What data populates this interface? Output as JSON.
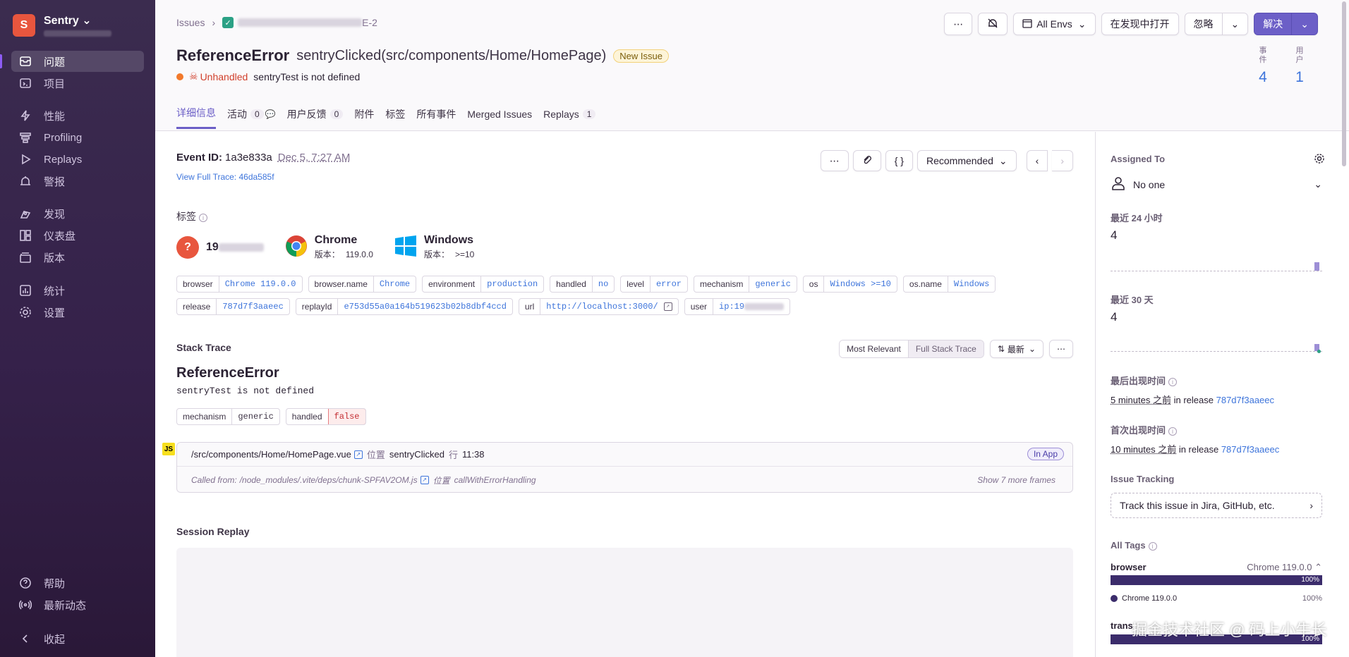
{
  "sidebar": {
    "org_initial": "S",
    "org_name": "Sentry",
    "items": [
      {
        "label": "问题",
        "icon": "issues-icon"
      },
      {
        "label": "项目",
        "icon": "projects-icon"
      },
      {
        "label": "性能",
        "icon": "performance-icon"
      },
      {
        "label": "Profiling",
        "icon": "profiling-icon"
      },
      {
        "label": "Replays",
        "icon": "replays-icon"
      },
      {
        "label": "警报",
        "icon": "alerts-icon"
      },
      {
        "label": "发现",
        "icon": "discover-icon"
      },
      {
        "label": "仪表盘",
        "icon": "dashboards-icon"
      },
      {
        "label": "版本",
        "icon": "releases-icon"
      },
      {
        "label": "统计",
        "icon": "stats-icon"
      },
      {
        "label": "设置",
        "icon": "settings-icon"
      }
    ],
    "help": "帮助",
    "whats_new": "最新动态",
    "collapse": "收起"
  },
  "header": {
    "breadcrumb_root": "Issues",
    "breadcrumb_project_suffix": "E-2",
    "title": "ReferenceError",
    "subtitle": "sentryClicked(src/components/Home/HomePage)",
    "new_badge": "New Issue",
    "unhandled": "Unhandled",
    "message": "sentryTest is not defined",
    "events_label": "事件",
    "events_value": "4",
    "users_label": "用户",
    "users_value": "1",
    "actions": {
      "more": "⋯",
      "envs": "All Envs",
      "open_discover": "在发现中打开",
      "ignore": "忽略",
      "resolve": "解决"
    },
    "tabs": [
      {
        "label": "详细信息",
        "count": null
      },
      {
        "label": "活动",
        "count": "0"
      },
      {
        "label": "用户反馈",
        "count": "0"
      },
      {
        "label": "附件",
        "count": null
      },
      {
        "label": "标签",
        "count": null
      },
      {
        "label": "所有事件",
        "count": null
      },
      {
        "label": "Merged Issues",
        "count": null
      },
      {
        "label": "Replays",
        "count": "1"
      }
    ]
  },
  "event": {
    "id_label": "Event ID:",
    "id": "1a3e833a",
    "date": "Dec 5, 7:27 AM",
    "trace_link": "View Full Trace: 46da585f",
    "recommended": "Recommended",
    "tags_title": "标签",
    "contexts": {
      "user_prefix": "19",
      "browser_name": "Chrome",
      "browser_ver_label": "版本：",
      "browser_ver": "119.0.0",
      "os_name": "Windows",
      "os_ver_label": "版本：",
      "os_ver": ">=10"
    },
    "tags_row1": [
      {
        "k": "browser",
        "v": "Chrome 119.0.0"
      },
      {
        "k": "browser.name",
        "v": "Chrome"
      },
      {
        "k": "environment",
        "v": "production"
      },
      {
        "k": "handled",
        "v": "no"
      },
      {
        "k": "level",
        "v": "error"
      },
      {
        "k": "mechanism",
        "v": "generic"
      },
      {
        "k": "os",
        "v": "Windows >=10"
      },
      {
        "k": "os.name",
        "v": "Windows"
      }
    ],
    "tags_row2": [
      {
        "k": "release",
        "v": "787d7f3aaeec"
      },
      {
        "k": "replayId",
        "v": "e753d55a0a164b519623b02b8dbf4ccd"
      },
      {
        "k": "url",
        "v": "http://localhost:3000/"
      },
      {
        "k": "user",
        "v": "ip:19"
      }
    ],
    "stack_title": "Stack Trace",
    "most_relevant": "Most Relevant",
    "full_stack": "Full Stack Trace",
    "newest": "最新",
    "err_title": "ReferenceError",
    "err_msg": "sentryTest is not defined",
    "mech_k": "mechanism",
    "mech_v": "generic",
    "handled_k": "handled",
    "handled_v": "false",
    "js_badge": "JS",
    "frame_file": "/src/components/Home/HomePage.vue",
    "frame_at": "位置",
    "frame_fn": "sentryClicked",
    "frame_line_label": "行",
    "frame_line": "11:38",
    "in_app": "In App",
    "called_from_label": "Called from:",
    "called_from": "/node_modules/.vite/deps/chunk-SPFAV2OM.js",
    "called_at": "位置",
    "called_fn": "callWithErrorHandling",
    "more_frames": "Show 7 more frames",
    "replay_title": "Session Replay"
  },
  "sidepanel": {
    "assigned_label": "Assigned To",
    "assignee": "No one",
    "last24_label": "最近 24 小时",
    "last24_value": "4",
    "last30_label": "最近 30 天",
    "last30_value": "4",
    "last_seen_label": "最后出现时间",
    "last_seen": "5 minutes 之前",
    "in_release": "in release",
    "release": "787d7f3aaeec",
    "first_seen_label": "首次出现时间",
    "first_seen": "10 minutes 之前",
    "tracking_label": "Issue Tracking",
    "tracking_text": "Track this issue in Jira, GitHub, etc.",
    "all_tags_label": "All Tags",
    "browser_tag": "browser",
    "browser_top": "Chrome 119.0.0",
    "pct": "100%",
    "chrome_row": "Chrome 119.0.0",
    "trans_tag": "trans"
  },
  "watermark": "掘金技术社区 @ 码上小牛长"
}
